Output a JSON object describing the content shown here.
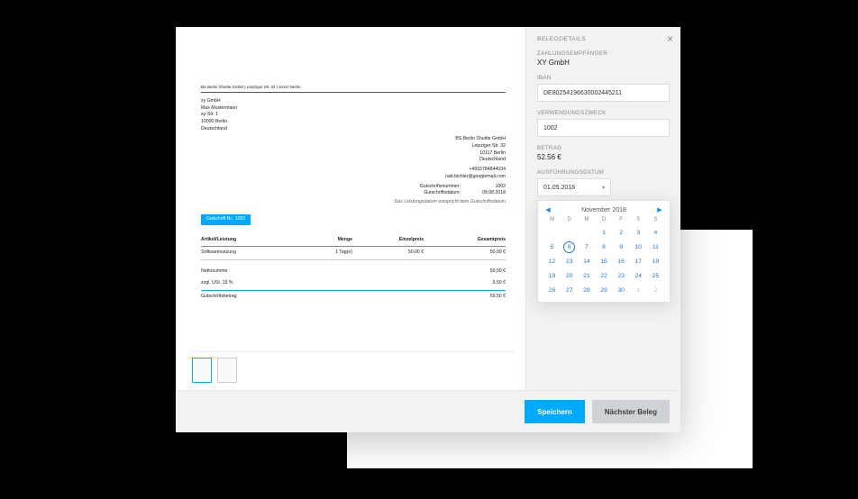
{
  "document": {
    "header_line": "BS Berlin Shuttle GmbH | Leipziger Str. 32 | 10117 Berlin",
    "recipient": {
      "company": "xy GmbH",
      "name": "Max Mustermann",
      "street": "xy-Str. 1",
      "city": "10000 Berlin",
      "country": "Deutschland"
    },
    "sender": {
      "company": "BS Berlin Shuttle GmbH",
      "street": "Leipziger Str. 32",
      "city": "10117 Berlin",
      "country": "Deutschland",
      "phone": "+4915784844034",
      "email": "natt.bichler@googlemail.com"
    },
    "meta": {
      "number_label": "Gutschriftsnummer:",
      "number_value": "1002",
      "date_label": "Gutschriftsdatum:",
      "date_value": "09.08.2018",
      "note": "Das Leistungsdatum entspricht dem Gutschriftsdatum"
    },
    "credit_note_label": "Gutschrift Nr.: 1002",
    "table": {
      "headers": {
        "item": "Artikel/Leistung",
        "qty": "Menge",
        "unit": "Einzelpreis",
        "total": "Gesamtpreis"
      },
      "rows": [
        {
          "item": "Softwarenutzung",
          "qty": "1 Tag(e)",
          "unit": "50,00 €",
          "total": "50,00 €"
        }
      ],
      "summary": {
        "net_label": "Nettosumme",
        "net_value": "50,00 €",
        "vat_label": "zzgl. USt. 19 %",
        "vat_value": "9,50 €",
        "gross_label": "Gutschriftsbetrag",
        "gross_value": "59,50 €"
      }
    }
  },
  "sidebar": {
    "title": "BELEGDETAILS",
    "payee_label": "ZAHLUNGSEMPFÄNGER",
    "payee_value": "XY GmbH",
    "iban_label": "IBAN",
    "iban_value": "DE80254196630002445211",
    "purpose_label": "VERWENDUNGSZWECK",
    "purpose_value": "1002",
    "amount_label": "BETRAG",
    "amount_value": "52.56 €",
    "execdate_label": "AUSFÜHRUNGSDATUM",
    "execdate_value": "01.05.2018"
  },
  "calendar": {
    "title": "November 2018",
    "dow": [
      "M",
      "D",
      "M",
      "D",
      "F",
      "S",
      "S"
    ],
    "weeks": [
      [
        {
          "n": "",
          "off": true
        },
        {
          "n": "",
          "off": true
        },
        {
          "n": "",
          "off": true
        },
        {
          "n": "1"
        },
        {
          "n": "2"
        },
        {
          "n": "3"
        },
        {
          "n": "4"
        }
      ],
      [
        {
          "n": "5"
        },
        {
          "n": "6",
          "sel": true
        },
        {
          "n": "7"
        },
        {
          "n": "8"
        },
        {
          "n": "9"
        },
        {
          "n": "10"
        },
        {
          "n": "11"
        }
      ],
      [
        {
          "n": "12"
        },
        {
          "n": "13"
        },
        {
          "n": "14"
        },
        {
          "n": "15"
        },
        {
          "n": "16"
        },
        {
          "n": "17"
        },
        {
          "n": "18"
        }
      ],
      [
        {
          "n": "19"
        },
        {
          "n": "20"
        },
        {
          "n": "21"
        },
        {
          "n": "22"
        },
        {
          "n": "23"
        },
        {
          "n": "24"
        },
        {
          "n": "25"
        }
      ],
      [
        {
          "n": "26"
        },
        {
          "n": "27"
        },
        {
          "n": "28"
        },
        {
          "n": "29"
        },
        {
          "n": "30"
        },
        {
          "n": "1",
          "off": true
        },
        {
          "n": "2",
          "off": true
        }
      ]
    ]
  },
  "footer": {
    "save": "Speichern",
    "next": "Nächster Beleg"
  }
}
